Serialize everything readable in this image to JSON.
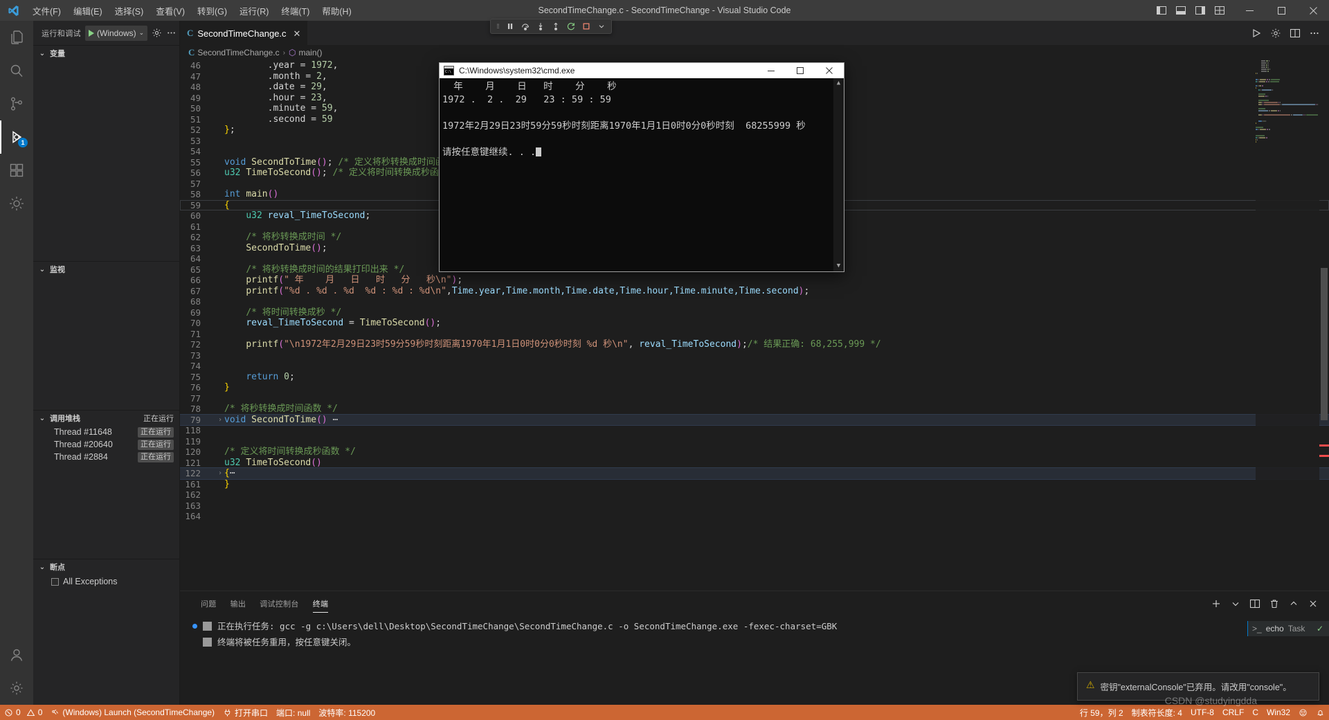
{
  "window": {
    "title": "SecondTimeChange.c - SecondTimeChange - Visual Studio Code",
    "minimize": "—",
    "maximize": "▢",
    "close": "✕"
  },
  "menu": [
    {
      "label": "文件(F)",
      "name": "menu-file"
    },
    {
      "label": "编辑(E)",
      "name": "menu-edit"
    },
    {
      "label": "选择(S)",
      "name": "menu-selection"
    },
    {
      "label": "查看(V)",
      "name": "menu-view"
    },
    {
      "label": "转到(G)",
      "name": "menu-go"
    },
    {
      "label": "运行(R)",
      "name": "menu-run"
    },
    {
      "label": "终端(T)",
      "name": "menu-terminal"
    },
    {
      "label": "帮助(H)",
      "name": "menu-help"
    }
  ],
  "activitybar": {
    "items": [
      {
        "icon": "files-icon",
        "name": "activity-explorer",
        "badge": ""
      },
      {
        "icon": "search-icon",
        "name": "activity-search",
        "badge": ""
      },
      {
        "icon": "source-control-icon",
        "name": "activity-source-control",
        "badge": ""
      },
      {
        "icon": "run-debug-icon",
        "name": "activity-run-debug",
        "badge": "1"
      },
      {
        "icon": "extensions-icon",
        "name": "activity-extensions",
        "badge": ""
      },
      {
        "icon": "gear-plugin-icon",
        "name": "activity-platformio",
        "badge": ""
      }
    ],
    "bottom": [
      {
        "icon": "account-icon",
        "name": "activity-account"
      },
      {
        "icon": "gear-icon",
        "name": "activity-settings"
      }
    ]
  },
  "sidebar": {
    "title": "运行和调试",
    "launch_config": "(Windows)",
    "gear_tooltip": "设置",
    "more_tooltip": "…",
    "sections": [
      {
        "title": "变量",
        "name": "section-variables",
        "status": "",
        "twisty": "⌄"
      },
      {
        "title": "监视",
        "name": "section-watch",
        "status": "",
        "twisty": "⌄"
      },
      {
        "title": "调用堆栈",
        "name": "section-callstack",
        "status": "正在运行",
        "twisty": "⌄"
      },
      {
        "title": "断点",
        "name": "section-breakpoints",
        "status": "",
        "twisty": "⌄"
      }
    ],
    "threads": [
      {
        "name": "Thread #11648",
        "status": "正在运行"
      },
      {
        "name": "Thread #20640",
        "status": "正在运行"
      },
      {
        "name": "Thread #2884",
        "status": "正在运行"
      }
    ],
    "breakpoints": [
      {
        "label": "All Exceptions",
        "checked": false
      }
    ]
  },
  "editor": {
    "tab": {
      "label": "SecondTimeChange.c",
      "icon": "c-file-icon",
      "close": "✕"
    },
    "breadcrumb": [
      {
        "label": "SecondTimeChange.c",
        "icon": "c-file-icon"
      },
      {
        "label": "main()",
        "icon": "method-icon"
      }
    ],
    "actions": [
      {
        "name": "run-code-icon",
        "label": "▷"
      },
      {
        "name": "settings-gear-icon",
        "label": "⚙"
      },
      {
        "name": "split-editor-icon",
        "label": "▥"
      },
      {
        "name": "more-actions-icon",
        "label": "…"
      }
    ]
  },
  "debug_toolbar": {
    "buttons": [
      {
        "name": "drag-handle-icon",
        "label": "⋮⋮"
      },
      {
        "name": "pause-button",
        "label": "❙❙"
      },
      {
        "name": "step-over-button",
        "label": "↷"
      },
      {
        "name": "step-into-button",
        "label": "↓"
      },
      {
        "name": "step-out-button",
        "label": "↑"
      },
      {
        "name": "restart-button",
        "label": "↺"
      },
      {
        "name": "stop-button",
        "label": "▣"
      },
      {
        "name": "dropdown-button",
        "label": "⌄"
      }
    ]
  },
  "code": {
    "lines": [
      {
        "n": "46",
        "indent": 2,
        "tokens": [
          {
            "t": ".year = ",
            "c": "op"
          },
          {
            "t": "1972",
            "c": "nu"
          },
          {
            "t": ",",
            "c": "op"
          }
        ]
      },
      {
        "n": "47",
        "indent": 2,
        "tokens": [
          {
            "t": ".month = ",
            "c": "op"
          },
          {
            "t": "2",
            "c": "nu"
          },
          {
            "t": ",",
            "c": "op"
          }
        ]
      },
      {
        "n": "48",
        "indent": 2,
        "tokens": [
          {
            "t": ".date = ",
            "c": "op"
          },
          {
            "t": "29",
            "c": "nu"
          },
          {
            "t": ",",
            "c": "op"
          }
        ]
      },
      {
        "n": "49",
        "indent": 2,
        "tokens": [
          {
            "t": ".hour = ",
            "c": "op"
          },
          {
            "t": "23",
            "c": "nu"
          },
          {
            "t": ",",
            "c": "op"
          }
        ]
      },
      {
        "n": "50",
        "indent": 2,
        "tokens": [
          {
            "t": ".minute = ",
            "c": "op"
          },
          {
            "t": "59",
            "c": "nu"
          },
          {
            "t": ",",
            "c": "op"
          }
        ]
      },
      {
        "n": "51",
        "indent": 2,
        "tokens": [
          {
            "t": ".second = ",
            "c": "op"
          },
          {
            "t": "59",
            "c": "nu"
          }
        ]
      },
      {
        "n": "52",
        "indent": 0,
        "tokens": [
          {
            "t": "}",
            "c": "ylw"
          },
          {
            "t": ";",
            "c": "op"
          }
        ]
      },
      {
        "n": "53",
        "indent": 0,
        "tokens": []
      },
      {
        "n": "54",
        "indent": 0,
        "tokens": []
      },
      {
        "n": "55",
        "indent": 0,
        "tokens": [
          {
            "t": "void",
            "c": "k"
          },
          {
            "t": " ",
            "c": "op"
          },
          {
            "t": "SecondToTime",
            "c": "fn"
          },
          {
            "t": "()",
            "c": "pn"
          },
          {
            "t": "; ",
            "c": "op"
          },
          {
            "t": "/* 定义将秒转换成时间函数 */",
            "c": "cm"
          }
        ]
      },
      {
        "n": "56",
        "indent": 0,
        "tokens": [
          {
            "t": "u32",
            "c": "kv"
          },
          {
            "t": " ",
            "c": "op"
          },
          {
            "t": "TimeToSecond",
            "c": "fn"
          },
          {
            "t": "()",
            "c": "pn"
          },
          {
            "t": "; ",
            "c": "op"
          },
          {
            "t": "/* 定义将时间转换成秒函数 */",
            "c": "cm"
          }
        ]
      },
      {
        "n": "57",
        "indent": 0,
        "tokens": []
      },
      {
        "n": "58",
        "indent": 0,
        "tokens": [
          {
            "t": "int",
            "c": "k"
          },
          {
            "t": " ",
            "c": "op"
          },
          {
            "t": "main",
            "c": "fn"
          },
          {
            "t": "()",
            "c": "pn"
          }
        ]
      },
      {
        "n": "59",
        "indent": 0,
        "cursor": true,
        "tokens": [
          {
            "t": "{",
            "c": "ylw"
          }
        ]
      },
      {
        "n": "60",
        "indent": 1,
        "tokens": [
          {
            "t": "u32",
            "c": "kv"
          },
          {
            "t": " ",
            "c": "op"
          },
          {
            "t": "reval_TimeToSecond",
            "c": "vr"
          },
          {
            "t": ";",
            "c": "op"
          }
        ]
      },
      {
        "n": "61",
        "indent": 1,
        "tokens": []
      },
      {
        "n": "62",
        "indent": 1,
        "tokens": [
          {
            "t": "/* 将秒转换成时间 */",
            "c": "cm"
          }
        ]
      },
      {
        "n": "63",
        "indent": 1,
        "tokens": [
          {
            "t": "SecondToTime",
            "c": "fn"
          },
          {
            "t": "()",
            "c": "pn"
          },
          {
            "t": ";",
            "c": "op"
          }
        ]
      },
      {
        "n": "64",
        "indent": 1,
        "tokens": []
      },
      {
        "n": "65",
        "indent": 1,
        "tokens": [
          {
            "t": "/* 将秒转换成时间的结果打印出来 */",
            "c": "cm"
          }
        ]
      },
      {
        "n": "66",
        "indent": 1,
        "tokens": [
          {
            "t": "printf",
            "c": "fn"
          },
          {
            "t": "(",
            "c": "pn"
          },
          {
            "t": "\" 年    月   日   时   分   秒\\n\"",
            "c": "st"
          },
          {
            "t": ")",
            "c": "pn"
          },
          {
            "t": ";",
            "c": "op"
          }
        ]
      },
      {
        "n": "67",
        "indent": 1,
        "tokens": [
          {
            "t": "printf",
            "c": "fn"
          },
          {
            "t": "(",
            "c": "pn"
          },
          {
            "t": "\"%d . %d . %d  %d : %d : %d\\n\"",
            "c": "st"
          },
          {
            "t": ",",
            "c": "op"
          },
          {
            "t": "Time.year,Time.month,Time.date,Time.hour,Time.minute,Time.second",
            "c": "vr"
          },
          {
            "t": ")",
            "c": "pn"
          },
          {
            "t": ";",
            "c": "op"
          }
        ]
      },
      {
        "n": "68",
        "indent": 1,
        "tokens": []
      },
      {
        "n": "69",
        "indent": 1,
        "tokens": [
          {
            "t": "/* 将时间转换成秒 */",
            "c": "cm"
          }
        ]
      },
      {
        "n": "70",
        "indent": 1,
        "tokens": [
          {
            "t": "reval_TimeToSecond",
            "c": "vr"
          },
          {
            "t": " = ",
            "c": "op"
          },
          {
            "t": "TimeToSecond",
            "c": "fn"
          },
          {
            "t": "()",
            "c": "pn"
          },
          {
            "t": ";",
            "c": "op"
          }
        ]
      },
      {
        "n": "71",
        "indent": 1,
        "tokens": []
      },
      {
        "n": "72",
        "indent": 1,
        "tokens": [
          {
            "t": "printf",
            "c": "fn"
          },
          {
            "t": "(",
            "c": "pn"
          },
          {
            "t": "\"\\n1972年2月29日23时59分59秒时刻距离1970年1月1日0时0分0秒时刻 %d 秒\\n\"",
            "c": "st"
          },
          {
            "t": ", ",
            "c": "op"
          },
          {
            "t": "reval_TimeToSecond",
            "c": "vr"
          },
          {
            "t": ")",
            "c": "pn"
          },
          {
            "t": ";",
            "c": "op"
          },
          {
            "t": "/* 结果正确: 68,255,999 */",
            "c": "cm"
          }
        ]
      },
      {
        "n": "73",
        "indent": 1,
        "tokens": []
      },
      {
        "n": "74",
        "indent": 1,
        "tokens": []
      },
      {
        "n": "75",
        "indent": 1,
        "tokens": [
          {
            "t": "return",
            "c": "k"
          },
          {
            "t": " ",
            "c": "op"
          },
          {
            "t": "0",
            "c": "nu"
          },
          {
            "t": ";",
            "c": "op"
          }
        ]
      },
      {
        "n": "76",
        "indent": 0,
        "tokens": [
          {
            "t": "}",
            "c": "ylw"
          }
        ]
      },
      {
        "n": "77",
        "indent": 0,
        "tokens": []
      },
      {
        "n": "78",
        "indent": 0,
        "tokens": [
          {
            "t": "/* 将秒转换成时间函数 */",
            "c": "cm"
          }
        ]
      },
      {
        "n": "79",
        "indent": 0,
        "fold": "⌄",
        "folded": true,
        "tokens": [
          {
            "t": "void",
            "c": "k"
          },
          {
            "t": " ",
            "c": "op"
          },
          {
            "t": "SecondToTime",
            "c": "fn"
          },
          {
            "t": "()",
            "c": "pn"
          },
          {
            "t": " ⋯",
            "c": "op"
          }
        ]
      },
      {
        "n": "118",
        "indent": 0,
        "tokens": []
      },
      {
        "n": "119",
        "indent": 0,
        "tokens": []
      },
      {
        "n": "120",
        "indent": 0,
        "tokens": [
          {
            "t": "/* 定义将时间转换成秒函数 */",
            "c": "cm"
          }
        ]
      },
      {
        "n": "121",
        "indent": 0,
        "tokens": [
          {
            "t": "u32",
            "c": "kv"
          },
          {
            "t": " ",
            "c": "op"
          },
          {
            "t": "TimeToSecond",
            "c": "fn"
          },
          {
            "t": "()",
            "c": "pn"
          }
        ]
      },
      {
        "n": "122",
        "indent": 0,
        "fold": "⌄",
        "folded": true,
        "tokens": [
          {
            "t": "{",
            "c": "ylw"
          },
          {
            "t": "⋯",
            "c": "op"
          }
        ]
      },
      {
        "n": "161",
        "indent": 0,
        "tokens": [
          {
            "t": "}",
            "c": "ylw"
          }
        ]
      },
      {
        "n": "162",
        "indent": 0,
        "tokens": []
      },
      {
        "n": "163",
        "indent": 0,
        "tokens": []
      },
      {
        "n": "164",
        "indent": 0,
        "tokens": []
      }
    ]
  },
  "cmd_window": {
    "title": "C:\\Windows\\system32\\cmd.exe",
    "icon": "cmd-icon",
    "minimize": "—",
    "maximize": "▢",
    "close": "✕",
    "output": [
      "  年    月    日   时    分    秒",
      "1972 .  2 .  29   23 : 59 : 59",
      "",
      "1972年2月29日23时59分59秒时刻距离1970年1月1日0时0分0秒时刻  68255999 秒",
      "",
      "请按任意键继续. . ."
    ]
  },
  "panel": {
    "tabs": [
      {
        "label": "问题",
        "name": "panel-tab-problems",
        "active": false
      },
      {
        "label": "输出",
        "name": "panel-tab-output",
        "active": false
      },
      {
        "label": "调试控制台",
        "name": "panel-tab-debug-console",
        "active": false
      },
      {
        "label": "终端",
        "name": "panel-tab-terminal",
        "active": true
      }
    ],
    "actions": [
      {
        "name": "new-terminal-icon",
        "label": "＋"
      },
      {
        "name": "terminal-dropdown-icon",
        "label": "⌄"
      },
      {
        "name": "split-terminal-icon",
        "label": "▥"
      },
      {
        "name": "trash-icon",
        "label": "🗑"
      },
      {
        "name": "maximize-panel-icon",
        "label": "⌃"
      },
      {
        "name": "close-panel-icon",
        "label": "✕"
      }
    ],
    "terminal_lines": [
      "正在执行任务: gcc -g c:\\Users\\dell\\Desktop\\SecondTimeChange\\SecondTimeChange.c -o SecondTimeChange.exe -fexec-charset=GBK",
      "终端将被任务重用，按任意键关闭。"
    ],
    "terminal_tab": {
      "prefix": ">_",
      "name": "echo",
      "suffix": "Task",
      "check": "✓"
    }
  },
  "toast": {
    "icon": "warning-icon",
    "message": "密钥\"externalConsole\"已弃用。请改用\"console\"。"
  },
  "statusbar": {
    "left": [
      {
        "name": "status-errors",
        "icon": "error-icon",
        "label": "0"
      },
      {
        "name": "status-warnings",
        "icon": "warning-triangle-icon",
        "label": "0"
      },
      {
        "name": "status-debug-launch",
        "icon": "debug-icon",
        "label": "(Windows) Launch (SecondTimeChange)"
      },
      {
        "name": "status-open-serial",
        "icon": "plug-icon",
        "label": "打开串口"
      },
      {
        "name": "status-port",
        "icon": "",
        "label": "端口: null"
      },
      {
        "name": "status-baud",
        "icon": "",
        "label": "波特率: 115200"
      }
    ],
    "right": [
      {
        "name": "status-cursor-position",
        "label": "行 59，列 2"
      },
      {
        "name": "status-indentation",
        "label": "制表符长度: 4"
      },
      {
        "name": "status-encoding",
        "label": "UTF-8"
      },
      {
        "name": "status-eol",
        "label": "CRLF"
      },
      {
        "name": "status-language",
        "label": "C"
      },
      {
        "name": "status-platform",
        "label": "Win32"
      },
      {
        "name": "status-feedback",
        "label": "☺"
      },
      {
        "name": "status-notifications",
        "label": "🔔"
      }
    ]
  },
  "watermark": "CSDN @studyingdda",
  "colors": {
    "statusbar_debug": "#cc6633",
    "accent": "#007acc",
    "editor_bg": "#1e1e1e",
    "sidebar_bg": "#252526",
    "titlebar_bg": "#3c3c3c"
  }
}
